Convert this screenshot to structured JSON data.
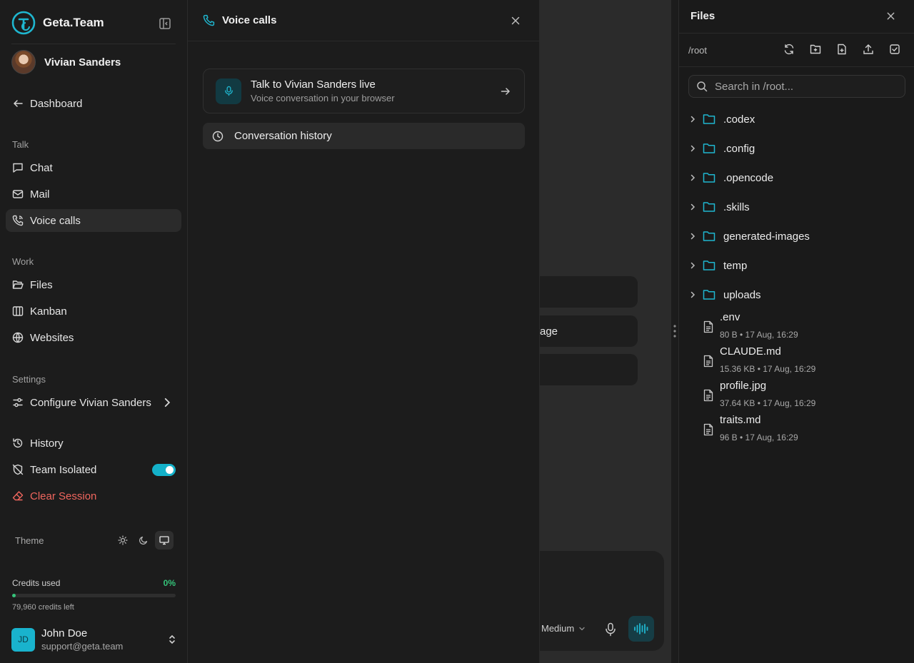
{
  "brand": {
    "name": "Geta.Team"
  },
  "agent": {
    "name": "Vivian Sanders"
  },
  "nav": {
    "dashboard": "Dashboard",
    "talk_label": "Talk",
    "chat": "Chat",
    "mail": "Mail",
    "voice_calls": "Voice calls",
    "work_label": "Work",
    "files": "Files",
    "kanban": "Kanban",
    "websites": "Websites",
    "settings_label": "Settings",
    "configure": "Configure Vivian Sanders",
    "history": "History",
    "team_isolated": "Team Isolated",
    "team_isolated_on": true,
    "clear_session": "Clear Session"
  },
  "theme": {
    "label": "Theme",
    "options": [
      "light",
      "dark",
      "system"
    ],
    "selected": "system"
  },
  "credits": {
    "label": "Credits used",
    "percent": "0%",
    "fraction_used": 0.02,
    "left": "79,960 credits left"
  },
  "user": {
    "initials": "JD",
    "name": "John Doe",
    "email": "support@geta.team"
  },
  "voice_panel": {
    "title": "Voice calls",
    "live_title": "Talk to Vivian Sanders live",
    "live_subtitle": "Voice conversation in your browser",
    "history_button": "Conversation history"
  },
  "chat": {
    "chips": [
      "",
      "age",
      ""
    ],
    "model": "Medium"
  },
  "files_panel": {
    "title": "Files",
    "path": "/root",
    "search_placeholder": "Search in /root...",
    "folders": [
      ".codex",
      ".config",
      ".opencode",
      ".skills",
      "generated-images",
      "temp",
      "uploads"
    ],
    "files": [
      {
        "name": ".env",
        "meta": "80 B • 17 Aug, 16:29"
      },
      {
        "name": "CLAUDE.md",
        "meta": "15.36 KB • 17 Aug, 16:29"
      },
      {
        "name": "profile.jpg",
        "meta": "37.64 KB • 17 Aug, 16:29"
      },
      {
        "name": "traits.md",
        "meta": "96 B • 17 Aug, 16:29"
      }
    ]
  },
  "colors": {
    "accent": "#1fb6cf",
    "danger": "#f0665e",
    "success": "#35c47a"
  }
}
